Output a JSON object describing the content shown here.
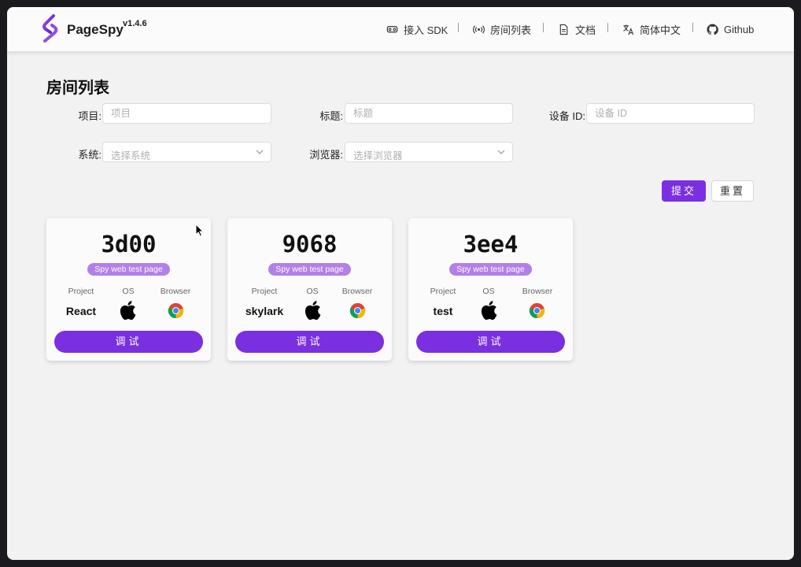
{
  "app": {
    "name": "PageSpy",
    "version": "v1.4.6"
  },
  "nav": [
    {
      "label": "接入 SDK",
      "icon": "vr-headset-icon"
    },
    {
      "label": "房间列表",
      "icon": "broadcast-icon"
    },
    {
      "label": "文档",
      "icon": "document-icon"
    },
    {
      "label": "简体中文",
      "icon": "translate-icon"
    },
    {
      "label": "Github",
      "icon": "github-icon"
    }
  ],
  "page": {
    "title": "房间列表"
  },
  "filters": {
    "project": {
      "label": "项目:",
      "placeholder": "项目"
    },
    "title": {
      "label": "标题:",
      "placeholder": "标题"
    },
    "device": {
      "label": "设备 ID:",
      "placeholder": "设备 ID"
    },
    "os": {
      "label": "系统:",
      "placeholder": "选择系统"
    },
    "browser": {
      "label": "浏览器:",
      "placeholder": "选择浏览器"
    }
  },
  "actions": {
    "submit": "提交",
    "reset": "重置"
  },
  "rooms": [
    {
      "id": "3d00",
      "tag": "Spy web test page",
      "project": "React",
      "os": "apple-icon",
      "browser": "chrome-icon",
      "button": "调试"
    },
    {
      "id": "9068",
      "tag": "Spy web test page",
      "project": "skylark",
      "os": "apple-icon",
      "browser": "chrome-icon",
      "button": "调试"
    },
    {
      "id": "3ee4",
      "tag": "Spy web test page",
      "project": "test",
      "os": "apple-icon",
      "browser": "chrome-icon",
      "button": "调试"
    }
  ],
  "columns": {
    "project": "Project",
    "os": "OS",
    "browser": "Browser"
  },
  "colors": {
    "accent": "#7a2fe0",
    "tag": "#b37fe8"
  }
}
